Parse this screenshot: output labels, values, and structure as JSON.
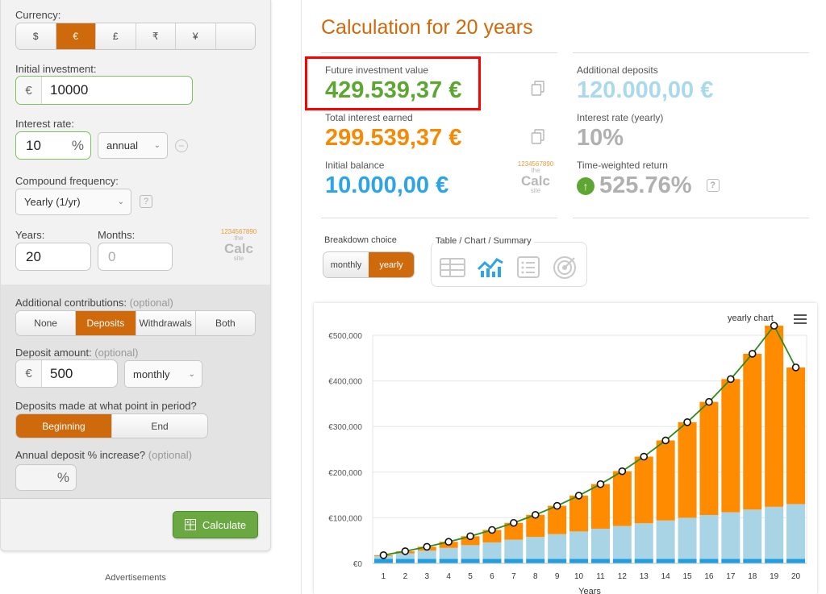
{
  "form": {
    "currency_label": "Currency:",
    "currencies": [
      "$",
      "€",
      "£",
      "₹",
      "¥",
      ""
    ],
    "selected_currency": "€",
    "initial_investment_label": "Initial investment:",
    "initial_investment_prefix": "€",
    "initial_investment_value": "10000",
    "interest_rate_label": "Interest rate:",
    "interest_rate_value": "10",
    "interest_rate_unit": "%",
    "interest_rate_period": "annual",
    "compound_frequency_label": "Compound frequency:",
    "compound_frequency_value": "Yearly (1/yr)",
    "years_label": "Years:",
    "years_value": "20",
    "months_label": "Months:",
    "months_placeholder": "0",
    "additional_contributions_label": "Additional contributions:",
    "optional_text": "(optional)",
    "contribution_options": [
      "None",
      "Deposits",
      "Withdrawals",
      "Both"
    ],
    "selected_contribution": "Deposits",
    "deposit_amount_label": "Deposit amount:",
    "deposit_prefix": "€",
    "deposit_value": "500",
    "deposit_frequency": "monthly",
    "deposits_timing_label": "Deposits made at what point in period?",
    "timing_options": [
      "Beginning",
      "End"
    ],
    "selected_timing": "Beginning",
    "annual_increase_label": "Annual deposit % increase?",
    "annual_increase_unit": "%",
    "calculate_label": "Calculate",
    "help_mark": "?",
    "minus_mark": "−"
  },
  "ads_label": "Advertisements",
  "logo": {
    "digits": "1234567890",
    "the": "the",
    "name": "Calc",
    "site": "site"
  },
  "results": {
    "title": "Calculation for 20 years",
    "future_value_label": "Future investment value",
    "future_value": "429.539,37 €",
    "additional_deposits_label": "Additional deposits",
    "additional_deposits": "120.000,00 €",
    "total_interest_label": "Total interest earned",
    "total_interest": "299.539,37 €",
    "interest_rate_label": "Interest rate (yearly)",
    "interest_rate": "10%",
    "initial_balance_label": "Initial balance",
    "initial_balance": "10.000,00 €",
    "twr_label": "Time-weighted return",
    "twr": "525.76%",
    "help_mark": "?"
  },
  "breakdown": {
    "label": "Breakdown choice",
    "options": [
      "monthly",
      "yearly"
    ],
    "selected": "yearly",
    "view_label": "Table / Chart / Summary",
    "view_icons": [
      "table-icon",
      "chart-icon",
      "list-icon",
      "target-icon"
    ],
    "selected_view": "chart-icon"
  },
  "colors": {
    "accent": "#cf6a0c",
    "green": "#5ea632",
    "orange": "#f58a07",
    "blue": "#2ca4e5",
    "light_blue": "#abd9ec",
    "deposit_bar": "#a8d4e6",
    "interest_bar": "#ff8c00",
    "initial_bar": "#1f9fe0",
    "highlight": "#ff0000"
  },
  "chart_data": {
    "type": "bar",
    "title": "yearly chart",
    "xlabel": "Years",
    "ylabel": "",
    "ylim": [
      0,
      500000
    ],
    "y_ticks": [
      0,
      100000,
      200000,
      300000,
      400000,
      500000
    ],
    "y_tick_labels": [
      "€0",
      "€100,000",
      "€200,000",
      "€300,000",
      "€400,000",
      "€500,000"
    ],
    "categories": [
      "1",
      "2",
      "3",
      "4",
      "5",
      "6",
      "7",
      "8",
      "9",
      "10",
      "11",
      "12",
      "13",
      "14",
      "15",
      "16",
      "17",
      "18",
      "19",
      "20"
    ],
    "stacked": true,
    "series": [
      {
        "kind": "bar",
        "color": "#1f9fe0",
        "values": [
          10000,
          10000,
          10000,
          10000,
          10000,
          10000,
          10000,
          10000,
          10000,
          10000,
          10000,
          10000,
          10000,
          10000,
          10000,
          10000,
          10000,
          10000,
          10000,
          10000
        ]
      },
      {
        "kind": "bar",
        "color": "#a8d4e6",
        "values": [
          6000,
          12000,
          18000,
          24000,
          30000,
          36000,
          42000,
          48000,
          54000,
          60000,
          66000,
          72000,
          78000,
          84000,
          90000,
          96000,
          102000,
          108000,
          114000,
          120000
        ]
      },
      {
        "kind": "bar",
        "color": "#ff8c00",
        "values": [
          2000,
          4700,
          8400,
          13300,
          19500,
          27300,
          36800,
          48400,
          62200,
          78600,
          97700,
          120000,
          146000,
          175500,
          209500,
          248000,
          292000,
          341500,
          397000,
          299539
        ]
      },
      {
        "kind": "line",
        "color": "#2e8b1e",
        "values": [
          18000,
          26700,
          36400,
          47300,
          59500,
          73300,
          88800,
          106400,
          126200,
          148600,
          173700,
          202000,
          234000,
          269500,
          309500,
          354000,
          404000,
          459500,
          521000,
          429539
        ]
      }
    ]
  }
}
